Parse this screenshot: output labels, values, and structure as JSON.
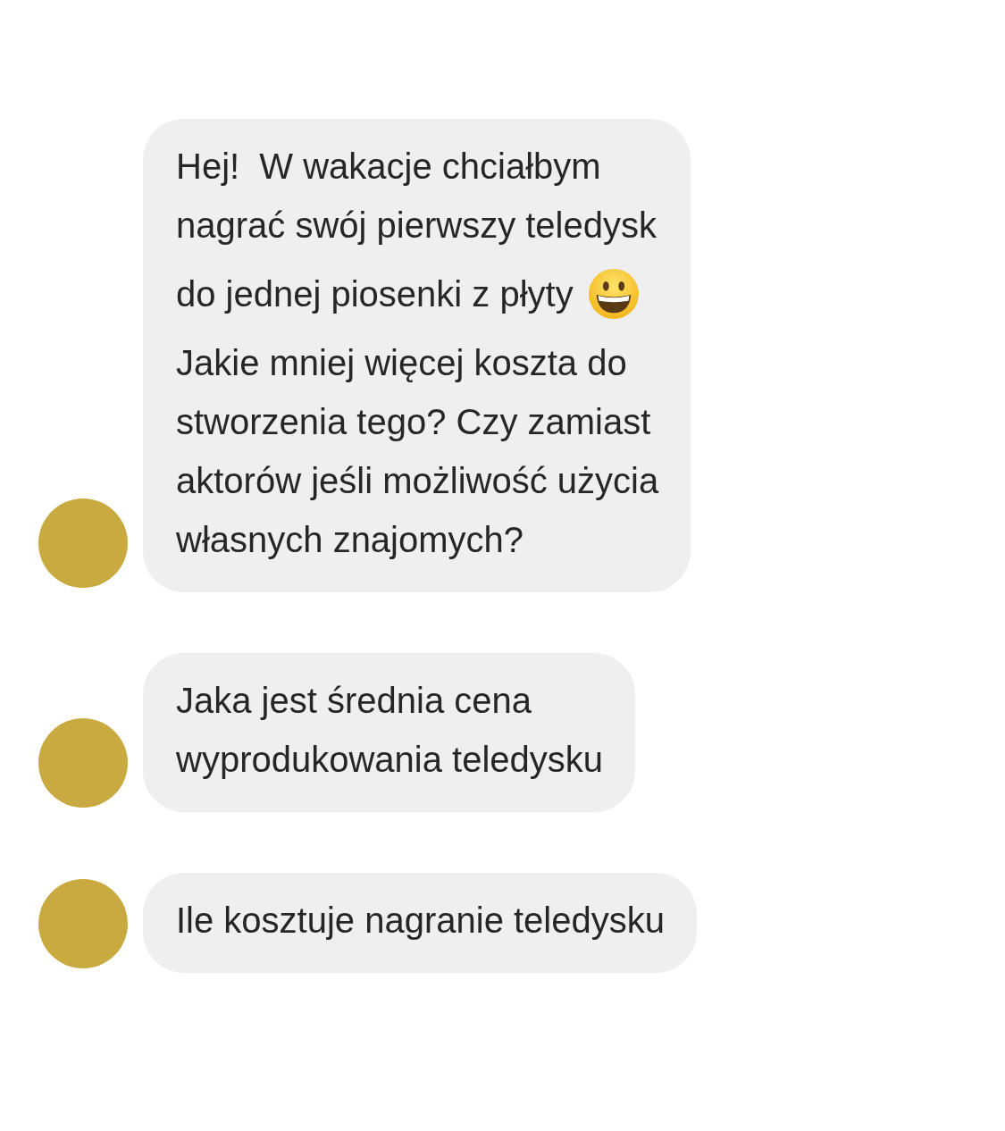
{
  "messages": [
    {
      "lines": [
        {
          "text": "Hej!  W wakacje chciałbym",
          "emoji": false
        },
        {
          "text": "nagrać swój pierwszy teledysk",
          "emoji": false
        },
        {
          "text": "do jednej piosenki z płyty",
          "emoji": true
        },
        {
          "text": "Jakie mniej więcej koszta do",
          "emoji": false
        },
        {
          "text": "stworzenia tego? Czy zamiast",
          "emoji": false
        },
        {
          "text": "aktorów jeśli możliwość użycia",
          "emoji": false
        },
        {
          "text": "własnych znajomych?",
          "emoji": false
        }
      ]
    },
    {
      "lines": [
        {
          "text": "Jaka jest średnia cena",
          "emoji": false
        },
        {
          "text": "wyprodukowania teledysku",
          "emoji": false
        }
      ]
    },
    {
      "lines": [
        {
          "text": "Ile kosztuje nagranie teledysku",
          "emoji": false
        }
      ]
    }
  ]
}
